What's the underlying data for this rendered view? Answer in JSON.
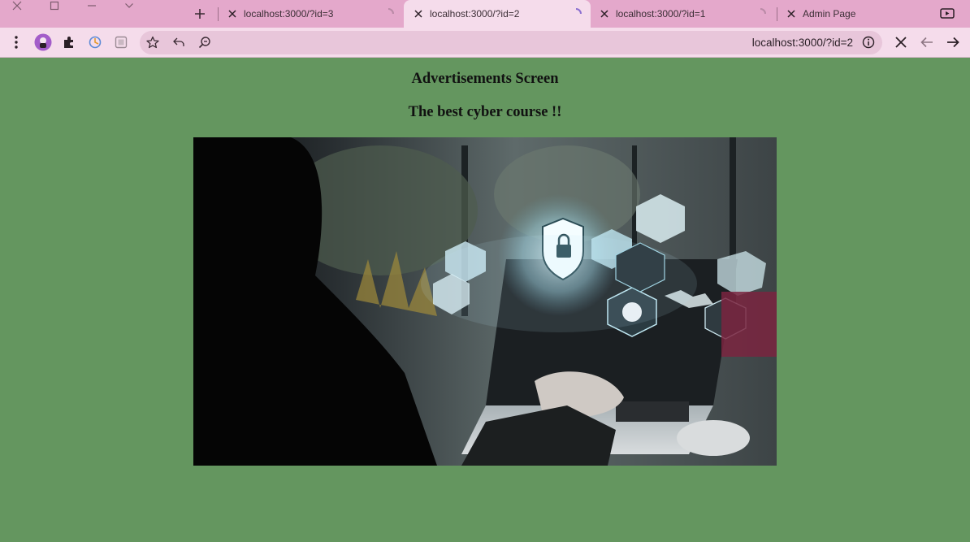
{
  "browser": {
    "tabs": [
      {
        "title": "localhost:3000/?id=3",
        "loading": true,
        "active": false
      },
      {
        "title": "localhost:3000/?id=2",
        "loading": true,
        "active": true
      },
      {
        "title": "localhost:3000/?id=1",
        "loading": true,
        "active": false
      },
      {
        "title": "Admin Page",
        "loading": false,
        "active": false
      }
    ],
    "address": {
      "url": "localhost:3000/?id=2"
    },
    "icons": {
      "window": [
        "close-icon",
        "maximize-icon",
        "minimize-icon",
        "tab-search-icon"
      ],
      "toolbar": [
        "menu-dots-icon",
        "profile-avatar-icon",
        "extensions-puzzle-icon",
        "extension-icon",
        "extension-icon",
        "bookmark-star-icon",
        "share-icon",
        "zoom-icon",
        "site-info-icon",
        "stop-icon",
        "back-icon",
        "forward-icon",
        "media-icon"
      ]
    }
  },
  "page": {
    "title": "Advertisements Screen",
    "subtitle": "The best cyber course !!",
    "image": {
      "description_visible": false
    }
  },
  "colors": {
    "page_background": "#64965f",
    "tabstrip": "#e4a8cb",
    "toolbar": "#f5dceb",
    "omnibox": "#e8c6da"
  }
}
